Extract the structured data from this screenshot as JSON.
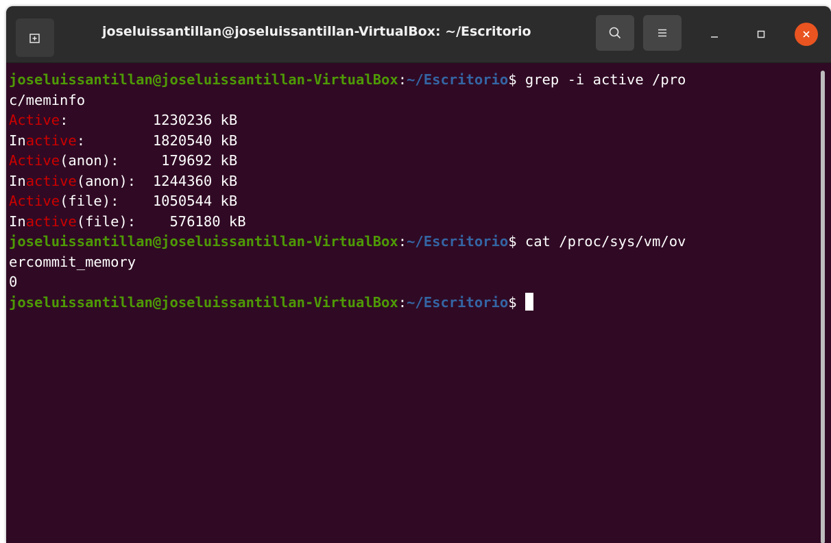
{
  "window": {
    "title": "joseluissantillan@joseluissantillan-VirtualBox: ~/Escritorio"
  },
  "icons": {
    "new_tab": "new-tab-icon",
    "search": "search-icon",
    "menu": "hamburger-menu-icon",
    "minimize": "minimize-icon",
    "maximize": "maximize-icon",
    "close": "close-icon"
  },
  "colors": {
    "terminal_bg": "#300a24",
    "prompt_user": "#4e9a06",
    "prompt_path": "#3465a4",
    "grep_match": "#cc0000",
    "close_button": "#e95420",
    "titlebar_bg": "#2c2c2c"
  },
  "prompt": {
    "user_host": "joseluissantillan@joseluissantillan-VirtualBox",
    "colon": ":",
    "path": "~/Escritorio",
    "symbol": "$ "
  },
  "commands": [
    {
      "first_line": "grep -i active /pro",
      "continuation": "c/meminfo"
    },
    {
      "first_line": "cat /proc/sys/vm/ov",
      "continuation": "ercommit_memory"
    }
  ],
  "meminfo_output": [
    {
      "pre": "",
      "match": "Active",
      "post": ":          1230236 kB"
    },
    {
      "pre": "In",
      "match": "active",
      "post": ":        1820540 kB"
    },
    {
      "pre": "",
      "match": "Active",
      "post": "(anon):     179692 kB"
    },
    {
      "pre": "In",
      "match": "active",
      "post": "(anon):  1244360 kB"
    },
    {
      "pre": "",
      "match": "Active",
      "post": "(file):    1050544 kB"
    },
    {
      "pre": "In",
      "match": "active",
      "post": "(file):    576180 kB"
    }
  ],
  "overcommit_output": "0"
}
